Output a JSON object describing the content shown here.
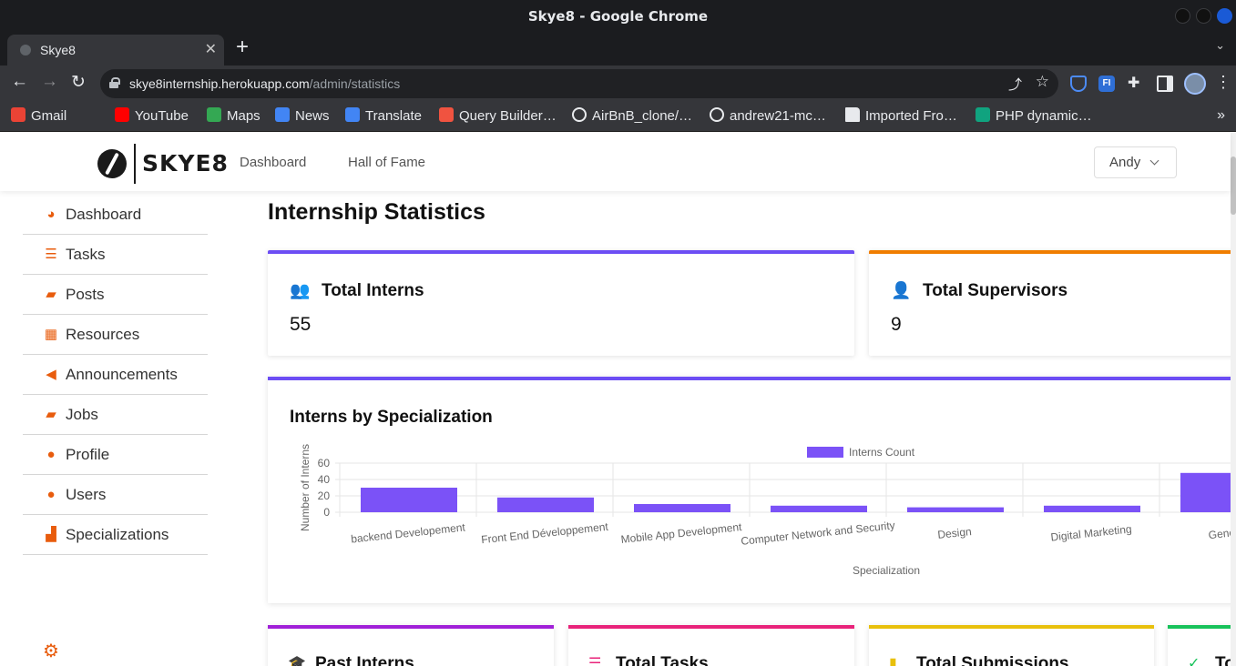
{
  "window": {
    "title": "Skye8 - Google Chrome"
  },
  "tab": {
    "title": "Skye8",
    "close": "✕",
    "new_tab": "+"
  },
  "address_bar": {
    "domain": "skye8internship.herokuapp.com",
    "path": "/admin/statistics"
  },
  "bookmarks": [
    {
      "label": "Gmail",
      "icon": "gmail-icon",
      "color": "#ea4335"
    },
    {
      "label": "YouTube",
      "icon": "youtube-icon",
      "color": "#ff0000"
    },
    {
      "label": "Maps",
      "icon": "maps-icon",
      "color": "#34a853"
    },
    {
      "label": "News",
      "icon": "news-icon",
      "color": "#4285f4"
    },
    {
      "label": "Translate",
      "icon": "translate-icon",
      "color": "#4285f4"
    },
    {
      "label": "Query Builder…",
      "icon": "laravel-icon",
      "color": "#f05340"
    },
    {
      "label": "AirBnB_clone/…",
      "icon": "github-icon",
      "color": "#e8eaed"
    },
    {
      "label": "andrew21-mc…",
      "icon": "github-icon",
      "color": "#e8eaed"
    },
    {
      "label": "Imported Fro…",
      "icon": "folder-icon",
      "color": "#e8eaed"
    },
    {
      "label": "PHP dynamic…",
      "icon": "chatgpt-icon",
      "color": "#10a37f"
    }
  ],
  "navbar": {
    "logo_text": "SKYE8",
    "links": [
      "Dashboard",
      "Hall of Fame"
    ],
    "user_name": "Andy"
  },
  "sidebar": {
    "items": [
      {
        "label": "Dashboard",
        "icon": "dashboard-icon",
        "glyph": "◕"
      },
      {
        "label": "Tasks",
        "icon": "tasks-icon",
        "glyph": "☰"
      },
      {
        "label": "Posts",
        "icon": "briefcase-icon",
        "glyph": "▰"
      },
      {
        "label": "Resources",
        "icon": "resources-icon",
        "glyph": "▦"
      },
      {
        "label": "Announcements",
        "icon": "megaphone-icon",
        "glyph": "◀"
      },
      {
        "label": "Jobs",
        "icon": "briefcase-icon",
        "glyph": "▰"
      },
      {
        "label": "Profile",
        "icon": "user-icon",
        "glyph": "●"
      },
      {
        "label": "Users",
        "icon": "users-icon",
        "glyph": "●"
      },
      {
        "label": "Specializations",
        "icon": "specializations-icon",
        "glyph": "▟"
      }
    ]
  },
  "main": {
    "title": "Internship Statistics",
    "cards": [
      {
        "title": "Total Interns",
        "value": "55",
        "icon": "users-icon",
        "color": "#6c4df4"
      },
      {
        "title": "Total Supervisors",
        "value": "9",
        "icon": "supervisor-icon",
        "color": "#f07d00"
      }
    ],
    "chart_title": "Interns by Specialization",
    "bottom_cards": [
      {
        "title": "Past Interns",
        "icon": "graduation-cap-icon",
        "color": "#a020d8"
      },
      {
        "title": "Total Tasks",
        "icon": "tasks-icon",
        "color": "#e8237a"
      },
      {
        "title": "Total Submissions",
        "icon": "file-icon",
        "color": "#e8c00c"
      },
      {
        "title": "To",
        "icon": "clipboard-check-icon",
        "color": "#17c25a"
      }
    ]
  },
  "chart_data": {
    "type": "bar",
    "categories": [
      "backend Developement",
      "Front End Développement",
      "Mobile App Development",
      "Computer Network and Security",
      "Design",
      "Digital Marketing",
      "General"
    ],
    "series": [
      {
        "name": "Interns Count",
        "values": [
          30,
          18,
          10,
          8,
          6,
          8,
          48
        ],
        "color": "#7b52f7"
      }
    ],
    "ylim": [
      0,
      60
    ],
    "yticks": [
      "60",
      "40",
      "20",
      "0"
    ],
    "xlabel": "Specialization",
    "ylabel": "Number of Interns",
    "legend": "top-center",
    "grid": true
  }
}
